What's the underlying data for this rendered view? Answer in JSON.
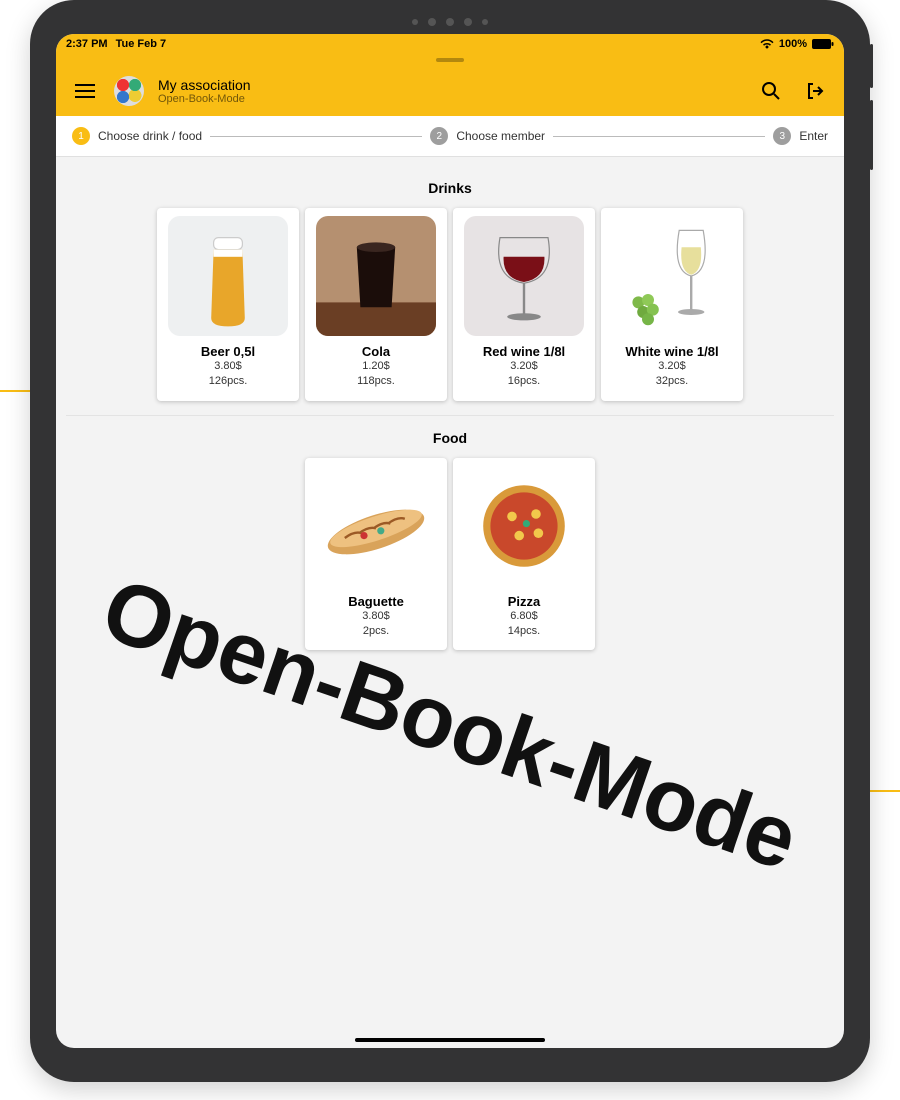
{
  "statusbar": {
    "time": "2:37 PM",
    "date": "Tue Feb 7",
    "battery": "100%"
  },
  "appbar": {
    "title": "My association",
    "subtitle": "Open-Book-Mode"
  },
  "stepper": {
    "steps": [
      {
        "num": "1",
        "label": "Choose drink / food"
      },
      {
        "num": "2",
        "label": "Choose member"
      },
      {
        "num": "3",
        "label": "Enter"
      }
    ]
  },
  "sections": {
    "drinks_title": "Drinks",
    "food_title": "Food"
  },
  "drinks": [
    {
      "name": "Beer 0,5l",
      "price": "3.80$",
      "stock": "126pcs."
    },
    {
      "name": "Cola",
      "price": "1.20$",
      "stock": "118pcs."
    },
    {
      "name": "Red wine 1/8l",
      "price": "3.20$",
      "stock": "16pcs."
    },
    {
      "name": "White wine 1/8l",
      "price": "3.20$",
      "stock": "32pcs."
    }
  ],
  "food": [
    {
      "name": "Baguette",
      "price": "3.80$",
      "stock": "2pcs."
    },
    {
      "name": "Pizza",
      "price": "6.80$",
      "stock": "14pcs."
    }
  ],
  "overlay": "Open-Book-Mode"
}
